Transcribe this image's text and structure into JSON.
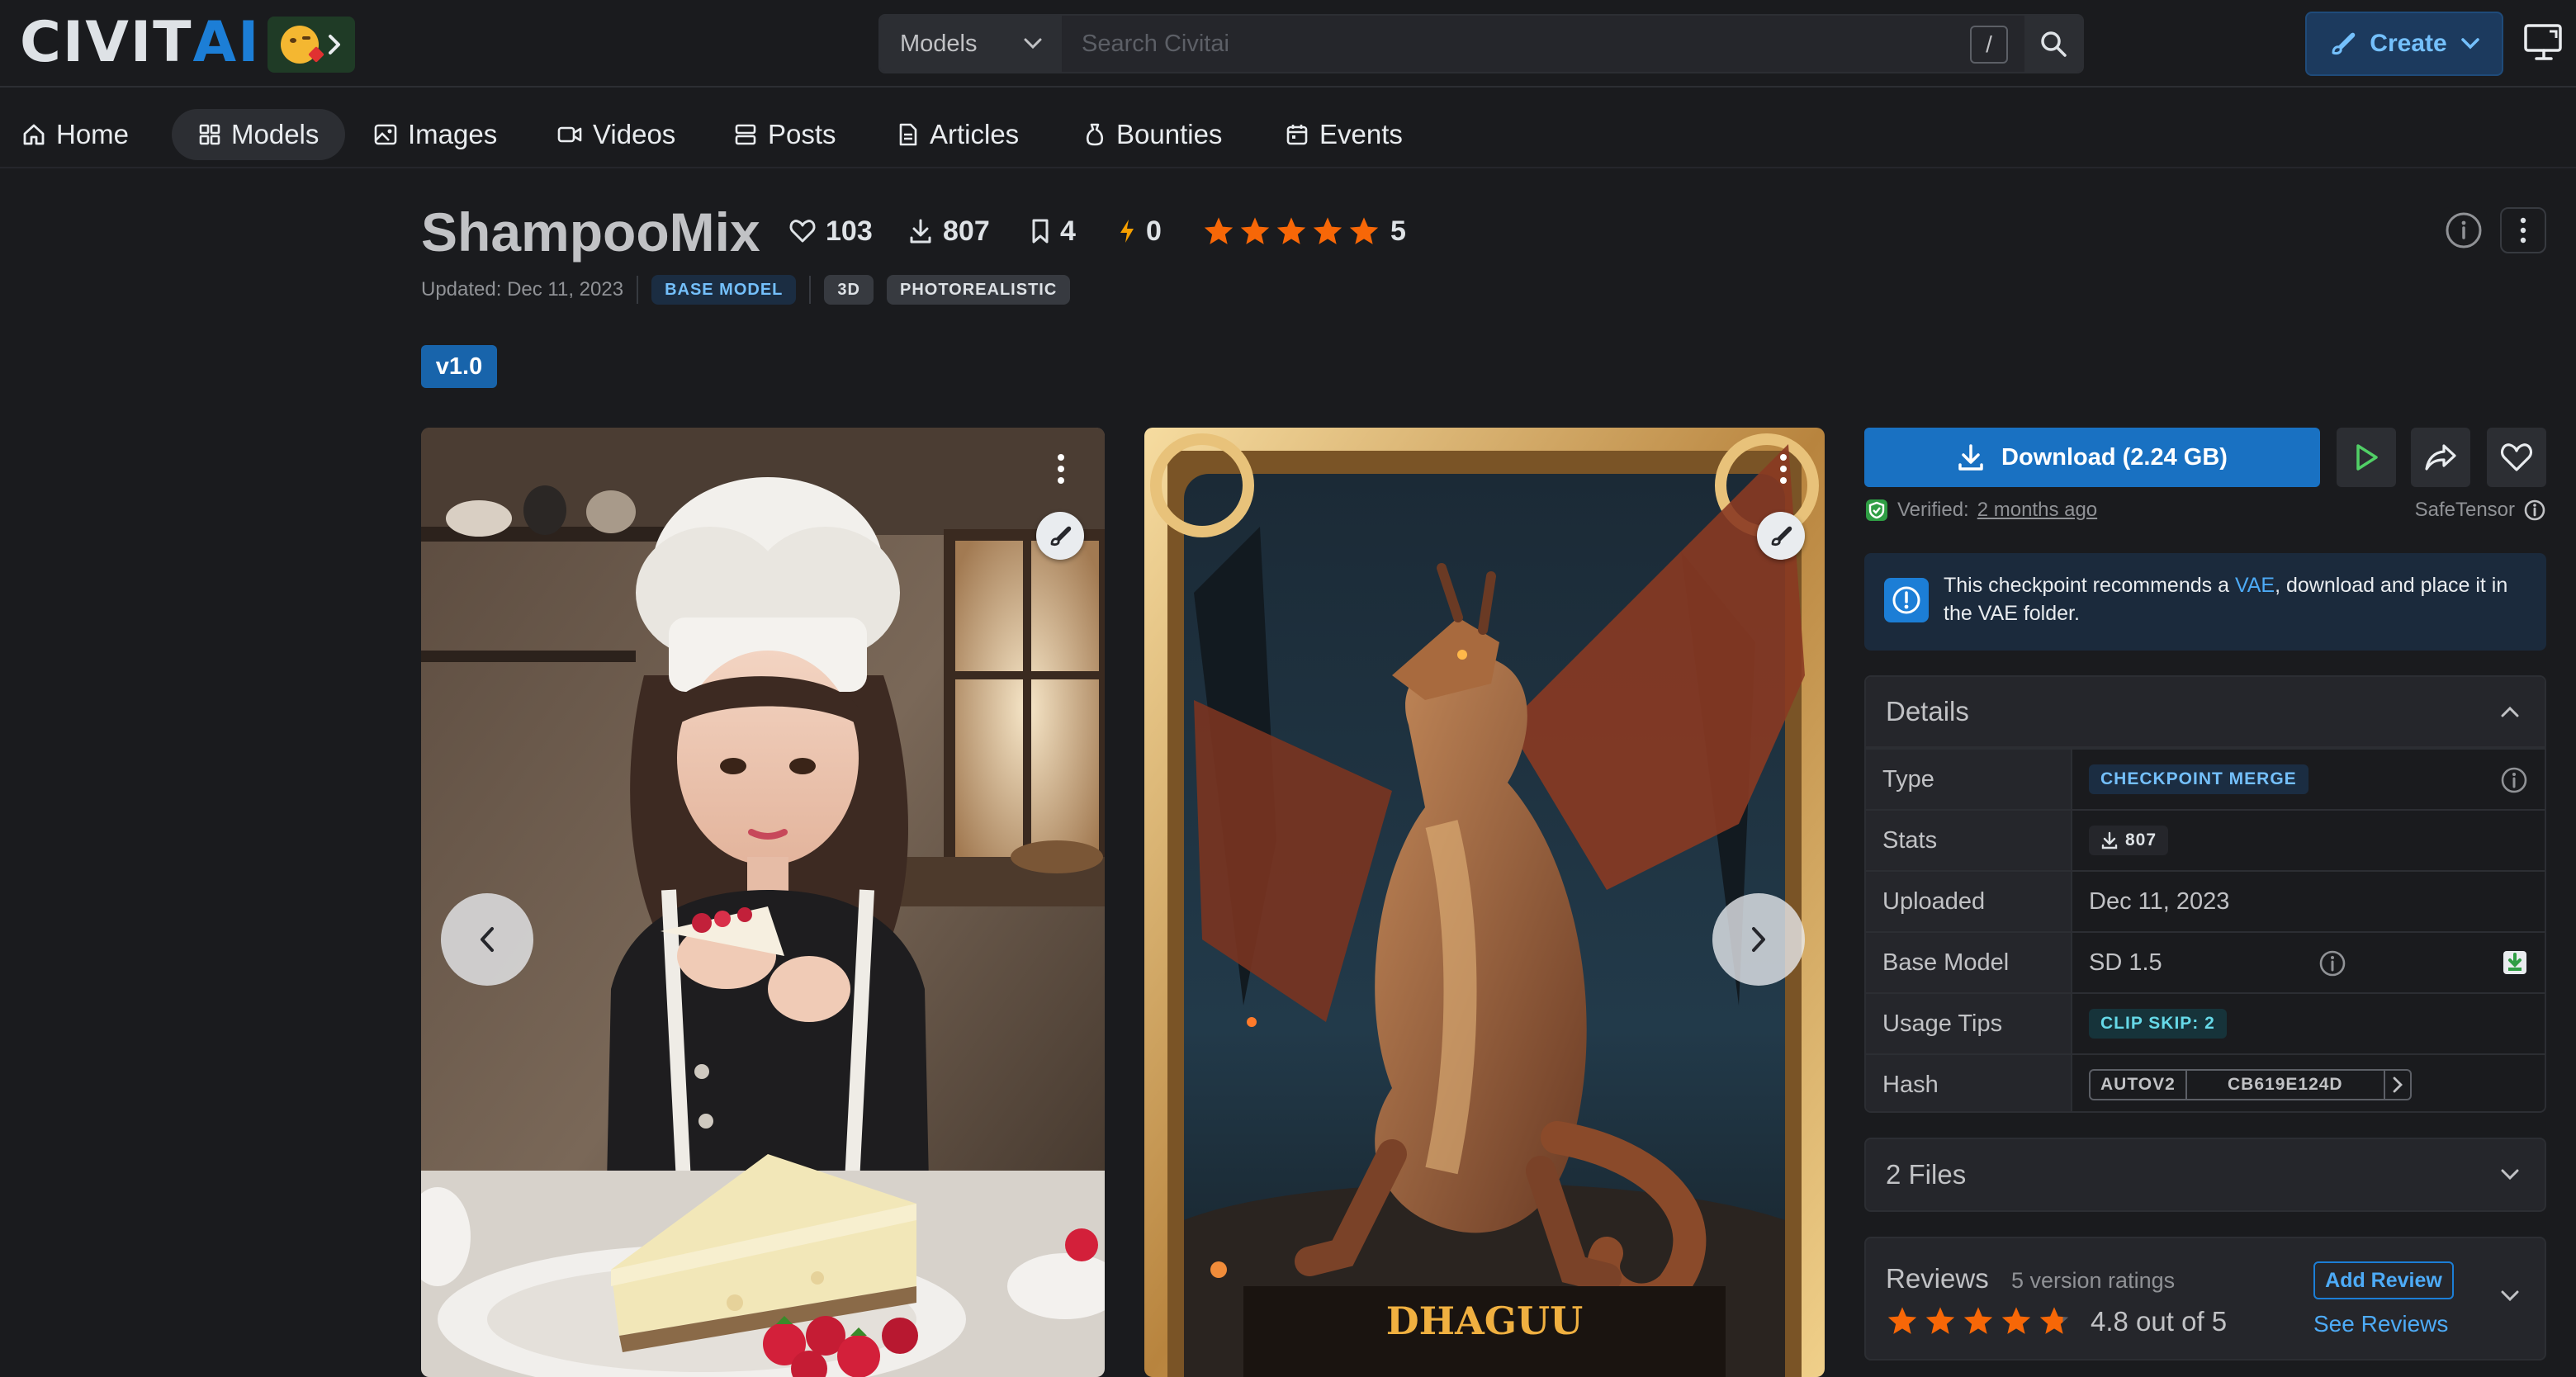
{
  "header": {
    "logo_a": "CIVIT",
    "logo_b": "AI",
    "search_scope": "Models",
    "search_placeholder": "Search Civitai",
    "search_shortcut": "/",
    "create_label": "Create"
  },
  "nav": {
    "items": [
      {
        "label": "Home",
        "icon": "home-icon"
      },
      {
        "label": "Models",
        "icon": "grid-icon"
      },
      {
        "label": "Images",
        "icon": "image-icon"
      },
      {
        "label": "Videos",
        "icon": "video-icon"
      },
      {
        "label": "Posts",
        "icon": "posts-icon"
      },
      {
        "label": "Articles",
        "icon": "article-icon"
      },
      {
        "label": "Bounties",
        "icon": "bounty-icon"
      },
      {
        "label": "Events",
        "icon": "calendar-icon"
      }
    ],
    "active": "Models"
  },
  "model": {
    "title": "ShampooMix",
    "likes": "103",
    "downloads": "807",
    "collects": "4",
    "buzz": "0",
    "rating_count": "5",
    "rating_stars": 5,
    "updated": "Updated: Dec 11, 2023",
    "tags": [
      "BASE MODEL",
      "3D",
      "PHOTOREALISTIC"
    ],
    "version": "v1.0"
  },
  "download": {
    "label": "Download (2.24 GB)",
    "verified_prefix": "Verified:",
    "verified_when": "2 months ago",
    "format": "SafeTensor"
  },
  "alert": {
    "text_a": "This checkpoint recommends a ",
    "link": "VAE",
    "text_b": ", download and place it in the VAE folder."
  },
  "details": {
    "title": "Details",
    "rows": [
      {
        "label": "Type",
        "value": "CHECKPOINT MERGE"
      },
      {
        "label": "Stats",
        "value": "807"
      },
      {
        "label": "Uploaded",
        "value": "Dec 11, 2023"
      },
      {
        "label": "Base Model",
        "value": "SD 1.5"
      },
      {
        "label": "Usage Tips",
        "value": "CLIP SKIP: 2"
      },
      {
        "label": "Hash",
        "value": "AUTOV2",
        "hash": "CB619E124D"
      }
    ]
  },
  "files": {
    "label": "2 Files"
  },
  "reviews": {
    "title": "Reviews",
    "count": "5 version ratings",
    "score": "4.8 out of 5",
    "rating": 4.8,
    "add_label": "Add Review",
    "see_label": "See Reviews"
  },
  "images": {
    "card2_caption": "DHAGUU"
  },
  "colors": {
    "accent": "#1c7ed6",
    "star": "#f76707",
    "bg": "#1a1b1e"
  }
}
